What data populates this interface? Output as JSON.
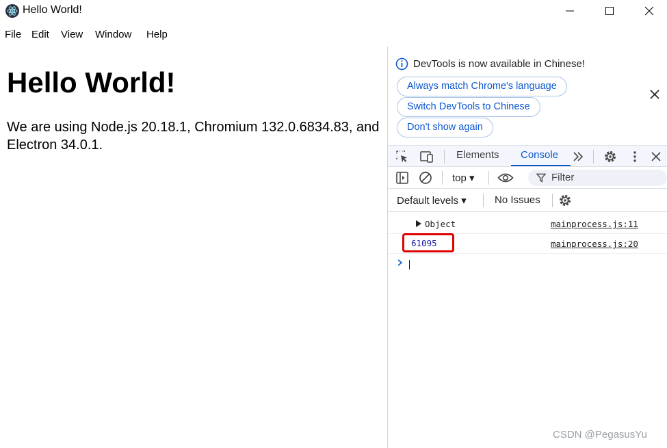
{
  "window": {
    "title": "Hello World!"
  },
  "menu": [
    "File",
    "Edit",
    "View",
    "Window",
    "Help"
  ],
  "page": {
    "heading": "Hello World!",
    "body_text": "We are using Node.js 20.18.1, Chromium 132.0.6834.83, and Electron 34.0.1."
  },
  "devtools": {
    "banner": {
      "message": "DevTools is now available in Chinese!",
      "buttons": [
        "Always match Chrome's language",
        "Switch DevTools to Chinese",
        "Don't show again"
      ]
    },
    "tabs": [
      "Elements",
      "Console"
    ],
    "active_tab": "Console",
    "context": "top ▾",
    "filter_placeholder": "Filter",
    "levels": "Default levels ▾",
    "issues": "No Issues",
    "messages": [
      {
        "text": "Object",
        "source": "mainprocess.js:11"
      },
      {
        "text": "61095",
        "source": "mainprocess.js:20"
      }
    ],
    "colors": {
      "accent": "#0b57d0",
      "highlight": "#e00000",
      "number": "#1a1aa6"
    }
  },
  "watermark": "CSDN @PegasusYu"
}
